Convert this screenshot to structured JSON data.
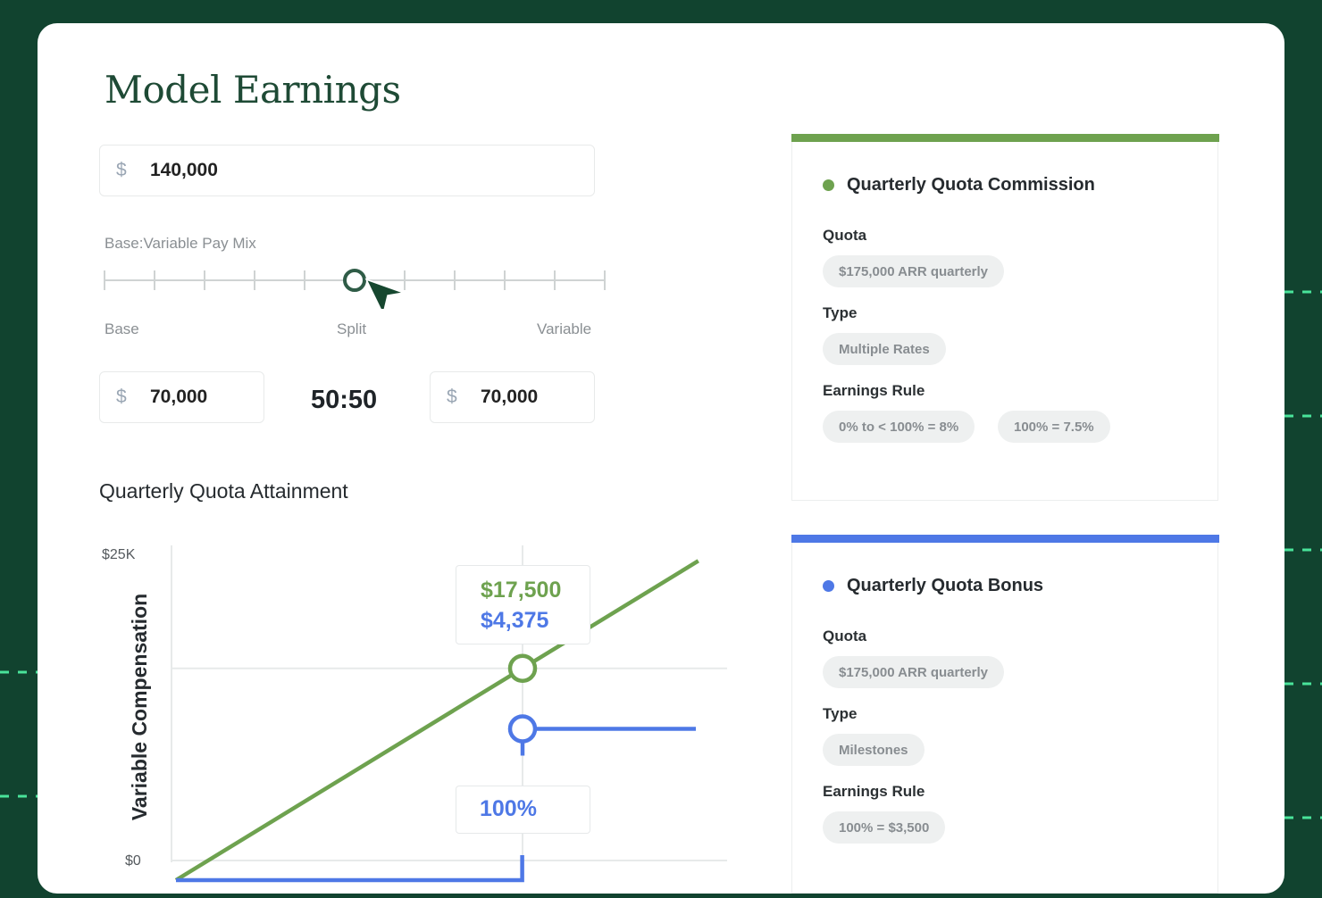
{
  "app": {
    "title": "Model Earnings"
  },
  "salary": {
    "currency": "$",
    "value": "140,000"
  },
  "pay_mix": {
    "label": "Base:Variable Pay Mix",
    "left_label": "Base",
    "center_label": "Split",
    "right_label": "Variable",
    "base_currency": "$",
    "base_value": "70,000",
    "ratio": "50:50",
    "variable_currency": "$",
    "variable_value": "70,000",
    "slider_position_fraction": 0.5
  },
  "attainment": {
    "title": "Quarterly Quota Attainment",
    "tooltip_green": "$17,500",
    "tooltip_blue": "$4,375",
    "attainment_label": "100%"
  },
  "colors": {
    "background": "#11432f",
    "accent_green": "#6ea24f",
    "accent_blue": "#4e78e6",
    "title_green": "#1e4a35"
  },
  "chart_data": {
    "type": "line",
    "title": "Quarterly Quota Attainment",
    "xlabel": "",
    "ylabel": "Variable Compensation",
    "y_tick_labels": [
      "$0",
      "$25K"
    ],
    "ylim": [
      0,
      25000
    ],
    "x_unit": "% of quarterly quota attained",
    "xlim": [
      0,
      200
    ],
    "grid": true,
    "series": [
      {
        "color": "#6ea24f",
        "x": [
          0,
          100,
          150
        ],
        "y": [
          0,
          17500,
          26250
        ]
      },
      {
        "color": "#4e78e6",
        "x": [
          0,
          99.9,
          100,
          150
        ],
        "y": [
          0,
          0,
          12500,
          12500
        ]
      }
    ],
    "marker": {
      "x": 100,
      "values": [
        17500,
        12500
      ]
    }
  },
  "plans": [
    {
      "title": "Quarterly Quota Commission",
      "color": "#6ea24f",
      "quota_label": "Quota",
      "quota_chip": "$175,000 ARR quarterly",
      "type_label": "Type",
      "type_chip": "Multiple Rates",
      "rule_label": "Earnings Rule",
      "rule_chips": [
        "0% to < 100% = 8%",
        "100% = 7.5%"
      ]
    },
    {
      "title": "Quarterly Quota Bonus",
      "color": "#4e78e6",
      "quota_label": "Quota",
      "quota_chip": "$175,000 ARR quarterly",
      "type_label": "Type",
      "type_chip": "Milestones",
      "rule_label": "Earnings Rule",
      "rule_chips": [
        "100% = $3,500"
      ]
    }
  ]
}
